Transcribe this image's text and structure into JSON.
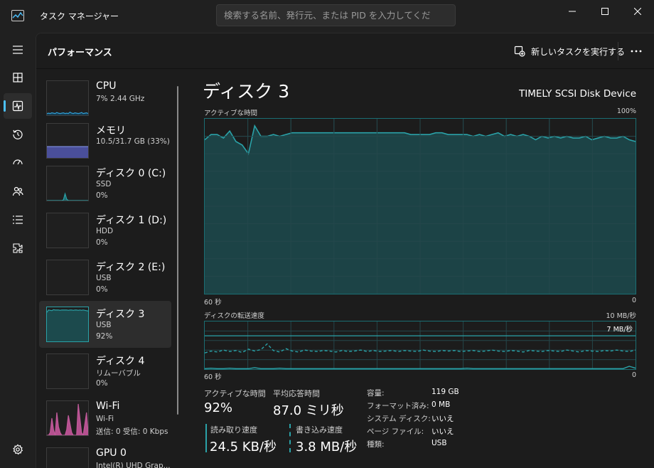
{
  "window": {
    "title": "タスク マネージャー",
    "search_placeholder": "検索する名前、発行元、または PID を入力してくだ"
  },
  "nav": {
    "items": [
      "hamburger-icon",
      "processes-icon",
      "performance-icon",
      "app-history-icon",
      "startup-icon",
      "users-icon",
      "details-icon",
      "services-icon"
    ],
    "active": "performance-icon",
    "bottom": "settings-icon"
  },
  "header": {
    "title": "パフォーマンス",
    "run_task_label": "新しいタスクを実行する",
    "more_label": "…"
  },
  "devices": [
    {
      "name": "CPU",
      "line1": "7%  2.44 GHz",
      "line2": ""
    },
    {
      "name": "メモリ",
      "line1": "10.5/31.7 GB (33%)",
      "line2": ""
    },
    {
      "name": "ディスク 0 (C:)",
      "line1": "SSD",
      "line2": "0%"
    },
    {
      "name": "ディスク 1 (D:)",
      "line1": "HDD",
      "line2": "0%"
    },
    {
      "name": "ディスク 2 (E:)",
      "line1": "USB",
      "line2": "0%"
    },
    {
      "name": "ディスク 3",
      "line1": "USB",
      "line2": "92%"
    },
    {
      "name": "ディスク 4",
      "line1": "リムーバブル",
      "line2": "0%"
    },
    {
      "name": "Wi-Fi",
      "line1": "Wi-Fi",
      "line2": "送信: 0 受信: 0 Kbps"
    },
    {
      "name": "GPU 0",
      "line1": "Intel(R) UHD Grap...",
      "line2": ""
    }
  ],
  "selected_device": "ディスク 3",
  "detail": {
    "title": "ディスク 3",
    "model": "TIMELY  SCSI Disk Device",
    "active_time_label": "アクティブな時間",
    "active_time_max": "100%",
    "graph1_left": "60 秒",
    "graph1_right": "0",
    "transfer_label": "ディスクの転送速度",
    "transfer_max": "10 MB/秒",
    "transfer_mark": "7 MB/秒",
    "graph2_left": "60 秒",
    "graph2_right": "0"
  },
  "stats": {
    "active_time_label": "アクティブな時間",
    "active_time_value": "92%",
    "avg_response_label": "平均応答時間",
    "avg_response_value": "87.0 ミリ秒",
    "read_label": "読み取り速度",
    "read_value": "24.5 KB/秒",
    "write_label": "書き込み速度",
    "write_value": "3.8 MB/秒"
  },
  "properties": [
    {
      "key": "容量:",
      "value": "119 GB"
    },
    {
      "key": "フォーマット済み:",
      "value": "0 MB"
    },
    {
      "key": "システム ディスク:",
      "value": "いいえ"
    },
    {
      "key": "ページ ファイル:",
      "value": "いいえ"
    },
    {
      "key": "種類:",
      "value": "USB"
    }
  ],
  "chart_data": [
    {
      "type": "area",
      "title": "アクティブな時間",
      "ylim": [
        0,
        100
      ],
      "xlabel_left": "60 秒",
      "xlabel_right": "0",
      "series": [
        {
          "values": [
            88,
            91,
            91,
            89,
            93,
            87,
            85,
            80,
            96,
            90,
            90,
            91,
            90,
            91,
            92,
            92,
            92,
            92,
            92,
            92,
            92,
            92,
            92,
            92,
            92,
            92,
            92,
            92,
            92,
            92,
            92,
            92,
            92,
            91,
            91,
            91,
            91,
            92,
            92,
            91,
            91,
            91,
            91,
            90,
            91,
            90,
            91,
            92,
            90,
            91,
            90,
            91,
            90,
            88,
            90,
            89,
            90,
            89,
            90,
            89,
            89,
            90,
            88,
            89,
            90,
            89,
            89,
            90,
            88,
            87
          ]
        }
      ],
      "color": "#2aa2a8"
    },
    {
      "type": "line",
      "title": "ディスクの転送速度",
      "ylim": [
        0,
        10
      ],
      "ylabel": "MB/秒",
      "reference_line": 7,
      "series": [
        {
          "name": "read",
          "values": [
            0.1,
            0.2,
            0.1,
            0.1,
            0.2,
            0.1,
            0.1,
            0.1,
            0.3,
            0.1,
            0.1,
            0.1,
            0.2,
            0.1,
            0.1,
            0.1,
            0.1,
            0.1,
            0.1,
            0.1,
            0.1,
            0.1,
            0.1,
            0.1,
            0.1,
            0.1,
            0.1,
            0.1,
            0.1,
            0.1,
            0.1,
            0.1,
            0.1,
            0.1,
            0.1,
            0.1,
            0.1,
            0.1,
            0.1,
            0.1,
            0.1,
            0.1,
            0.2,
            0.1,
            0.1,
            0.1,
            0.1,
            0.1,
            0.1,
            0.1,
            0.1,
            0.1,
            0.1,
            0.1,
            0.1,
            0.1,
            0.1,
            0.1,
            0.1,
            0.1,
            0.1,
            0.1,
            0.1,
            0.1,
            0.1,
            0.1,
            0.1,
            0.1,
            0.6,
            0.2
          ],
          "style": "solid"
        },
        {
          "name": "write",
          "values": [
            3.4,
            3.8,
            3.6,
            4.0,
            3.7,
            3.9,
            3.5,
            4.2,
            3.8,
            4.1,
            5.3,
            3.9,
            3.6,
            4.3,
            3.8,
            3.6,
            4.0,
            3.8,
            3.7,
            3.9,
            3.8,
            3.6,
            3.9,
            3.7,
            3.8,
            4.0,
            3.7,
            3.9,
            3.7,
            3.8,
            3.9,
            3.7,
            3.9,
            3.8,
            3.7,
            4.0,
            3.8,
            3.7,
            3.9,
            3.8,
            3.9,
            3.7,
            3.8,
            3.9,
            3.7,
            3.8,
            4.0,
            3.8,
            3.7,
            3.9,
            3.8,
            3.6,
            3.9,
            3.8,
            3.7,
            3.9,
            3.8,
            3.7,
            4.0,
            3.8,
            3.6,
            3.9,
            3.8,
            3.7,
            3.9,
            3.8,
            4.0,
            3.8,
            3.7,
            4.0
          ],
          "style": "dashed"
        }
      ],
      "color": "#2aa2a8"
    }
  ],
  "thumbnails": {
    "cpu": [
      5,
      6,
      5,
      7,
      6,
      5,
      8,
      6,
      5,
      6,
      7,
      5,
      6,
      5,
      9,
      6,
      5,
      7,
      6,
      5,
      6,
      8,
      5,
      6,
      7,
      5
    ],
    "memory": [
      33,
      33,
      33,
      33,
      33,
      33,
      33,
      33,
      33,
      33,
      33,
      33,
      33,
      33,
      33,
      33,
      33,
      33,
      33,
      33,
      33,
      33,
      33,
      33,
      33,
      33
    ],
    "disk0": [
      0,
      0,
      0,
      0,
      0,
      0,
      0,
      0,
      0,
      0,
      2,
      20,
      4,
      0,
      0,
      0,
      0,
      0,
      0,
      0,
      0,
      0,
      0,
      0,
      0,
      0
    ],
    "disk3": [
      85,
      92,
      91,
      90,
      93,
      92,
      92,
      92,
      91,
      92,
      92,
      92,
      92,
      91,
      92,
      92,
      91,
      92,
      92,
      91,
      92,
      91,
      92,
      91,
      90,
      89
    ],
    "wifi": [
      0,
      0,
      5,
      30,
      10,
      0,
      40,
      15,
      5,
      0,
      0,
      0,
      10,
      35,
      20,
      5,
      0,
      0,
      0,
      55,
      30,
      5,
      0,
      20,
      40,
      5
    ]
  }
}
